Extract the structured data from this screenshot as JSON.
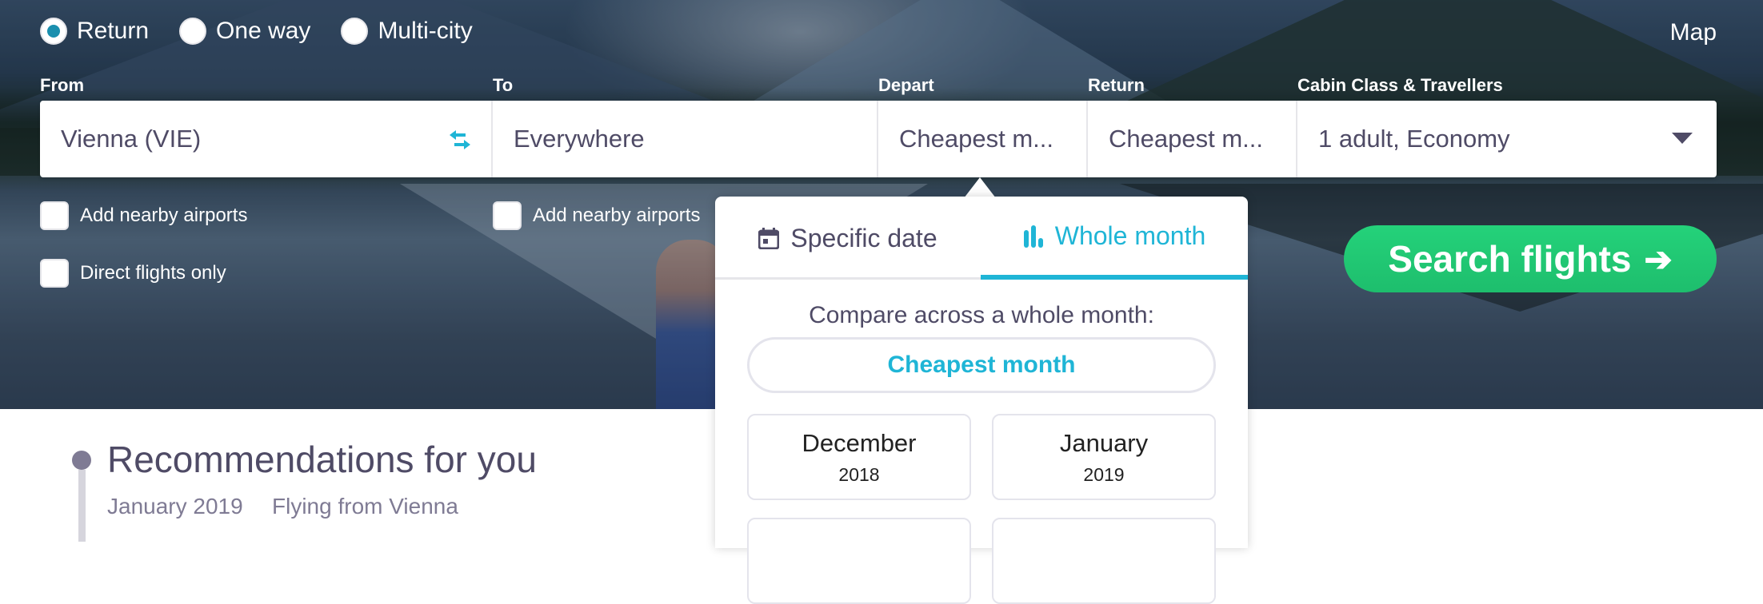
{
  "trip_types": [
    {
      "label": "Return",
      "checked": true
    },
    {
      "label": "One way",
      "checked": false
    },
    {
      "label": "Multi-city",
      "checked": false
    }
  ],
  "map_link": "Map",
  "fields": {
    "from": {
      "label": "From",
      "value": "Vienna (VIE)"
    },
    "to": {
      "label": "To",
      "value": "Everywhere"
    },
    "depart": {
      "label": "Depart",
      "value": "Cheapest m..."
    },
    "return": {
      "label": "Return",
      "value": "Cheapest m..."
    },
    "cabin": {
      "label": "Cabin Class & Travellers",
      "value": "1 adult, Economy"
    }
  },
  "options": {
    "from_nearby": "Add nearby airports",
    "to_nearby": "Add nearby airports",
    "direct_only": "Direct flights only"
  },
  "search_button": {
    "label": "Search flights",
    "icon": "arrow-right-icon",
    "arrow": "➔"
  },
  "date_popover": {
    "tabs": [
      {
        "label": "Specific date",
        "icon": "calendar-icon",
        "active": false
      },
      {
        "label": "Whole month",
        "icon": "bar-chart-icon",
        "active": true
      }
    ],
    "compare_text": "Compare across a whole month:",
    "cheapest_month_label": "Cheapest month",
    "months": [
      {
        "name": "December",
        "year": "2018"
      },
      {
        "name": "January",
        "year": "2019"
      }
    ]
  },
  "recommendations": {
    "title": "Recommendations for you",
    "month": "January 2019",
    "origin": "Flying from Vienna"
  },
  "colors": {
    "accent": "#1fb5d6",
    "radio_checked": "#1a8fae",
    "search_green": "#1ec56f",
    "text_primary": "#4f4b66"
  }
}
